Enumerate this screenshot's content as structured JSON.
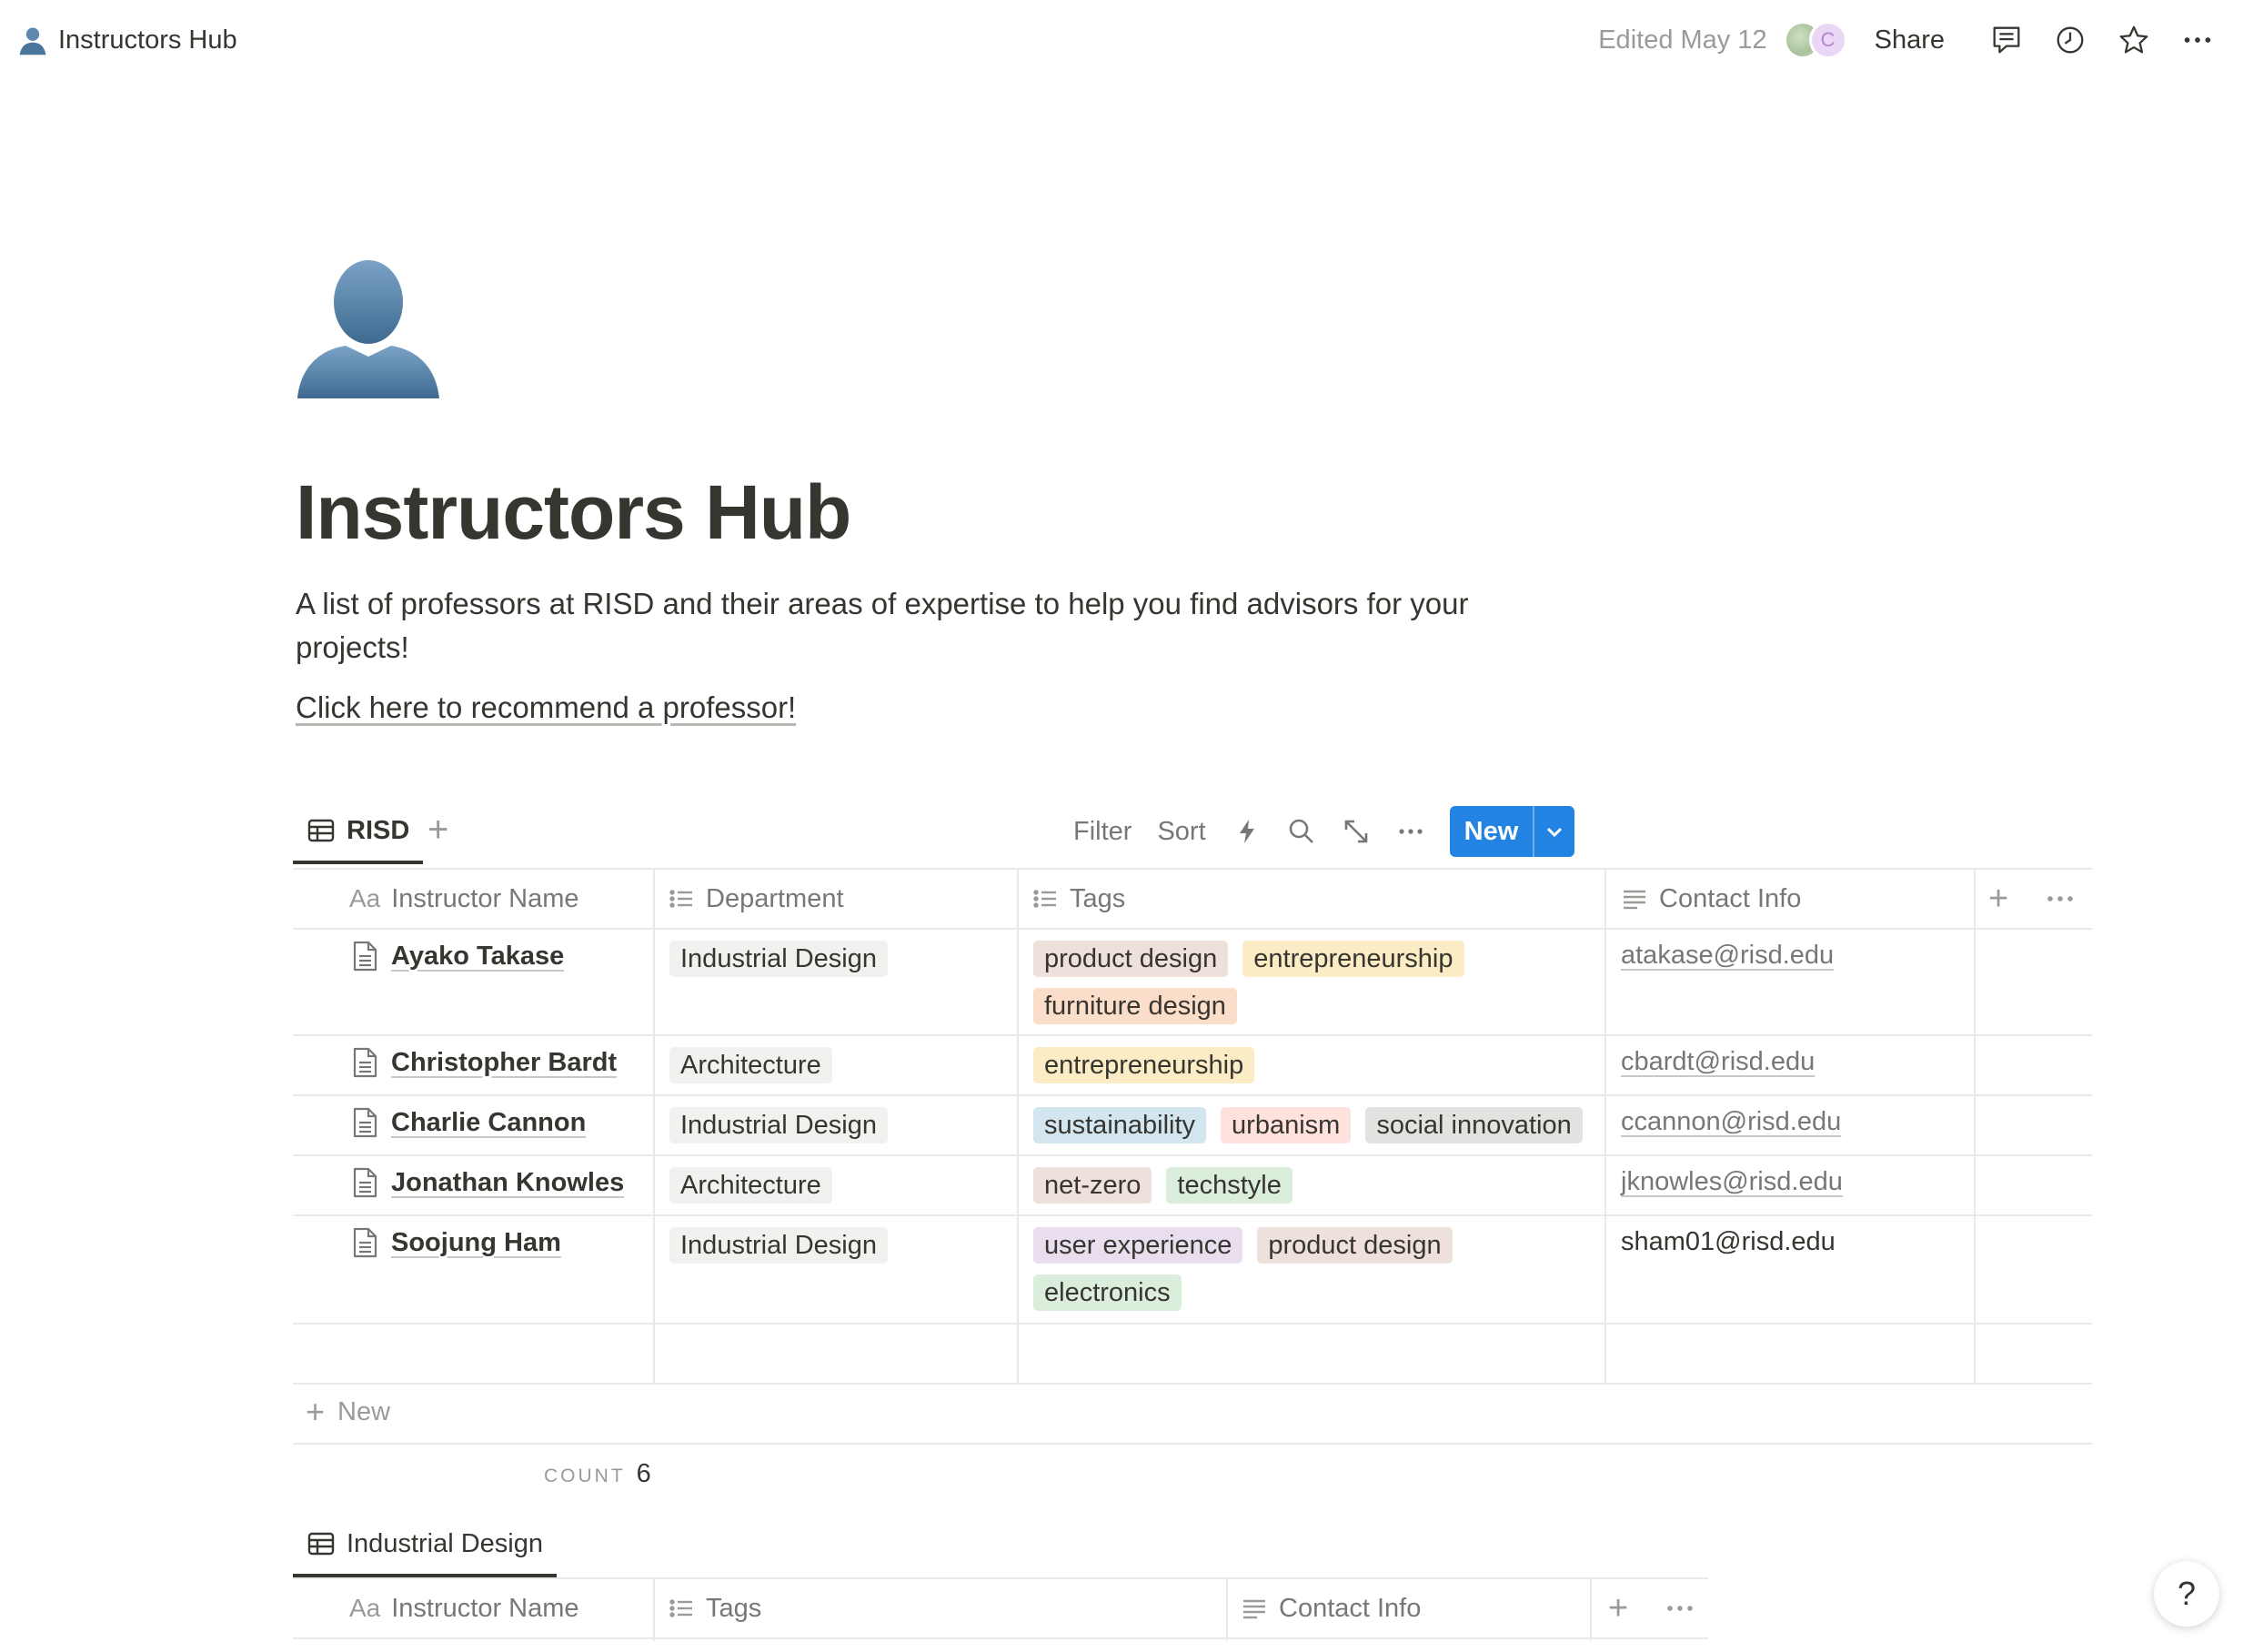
{
  "topbar": {
    "page_title": "Instructors Hub",
    "edited": "Edited May 12",
    "avatar_letter": "C",
    "share_label": "Share"
  },
  "page": {
    "title": "Instructors Hub",
    "description": "A list of professors at RISD and their areas of expertise to help you find advisors for your projects!",
    "link_text": "Click here to recommend a professor!"
  },
  "db1": {
    "view_tab": "RISD",
    "toolbar": {
      "filter": "Filter",
      "sort": "Sort",
      "new": "New"
    },
    "columns": [
      "Instructor Name",
      "Department",
      "Tags",
      "Contact Info"
    ],
    "rows": [
      {
        "name": "Ayako Takase",
        "department": "Industrial Design",
        "tags": [
          "product design",
          "entrepreneurship",
          "furniture design"
        ],
        "contact": "atakase@risd.edu"
      },
      {
        "name": "Christopher Bardt",
        "department": "Architecture",
        "tags": [
          "entrepreneurship"
        ],
        "contact": "cbardt@risd.edu"
      },
      {
        "name": "Charlie Cannon",
        "department": "Industrial Design",
        "tags": [
          "sustainability",
          "urbanism",
          "social innovation"
        ],
        "contact": "ccannon@risd.edu"
      },
      {
        "name": "Jonathan Knowles",
        "department": "Architecture",
        "tags": [
          "net-zero",
          "techstyle"
        ],
        "contact": "jknowles@risd.edu"
      },
      {
        "name": "Soojung Ham",
        "department": "Industrial Design",
        "tags": [
          "user experience",
          "product design",
          "electronics"
        ],
        "contact": "sham01@risd.edu"
      }
    ],
    "new_row_label": "New",
    "count_label": "COUNT",
    "count_value": "6"
  },
  "db2": {
    "view_tab": "Industrial Design",
    "columns": [
      "Instructor Name",
      "Tags",
      "Contact Info"
    ]
  },
  "tag_colors": {
    "product design": "#eee0da",
    "entrepreneurship": "#fbecc5",
    "furniture design": "#fadec9",
    "sustainability": "#d3e5ef",
    "urbanism": "#ffe2dd",
    "social innovation": "#e3e2e0",
    "net-zero": "#eee0da",
    "techstyle": "#dbeddb",
    "user experience": "#e8deee",
    "electronics": "#dbeddb",
    "department": "#f1f1ef"
  },
  "accent_color": "#2383e2",
  "help_label": "?"
}
